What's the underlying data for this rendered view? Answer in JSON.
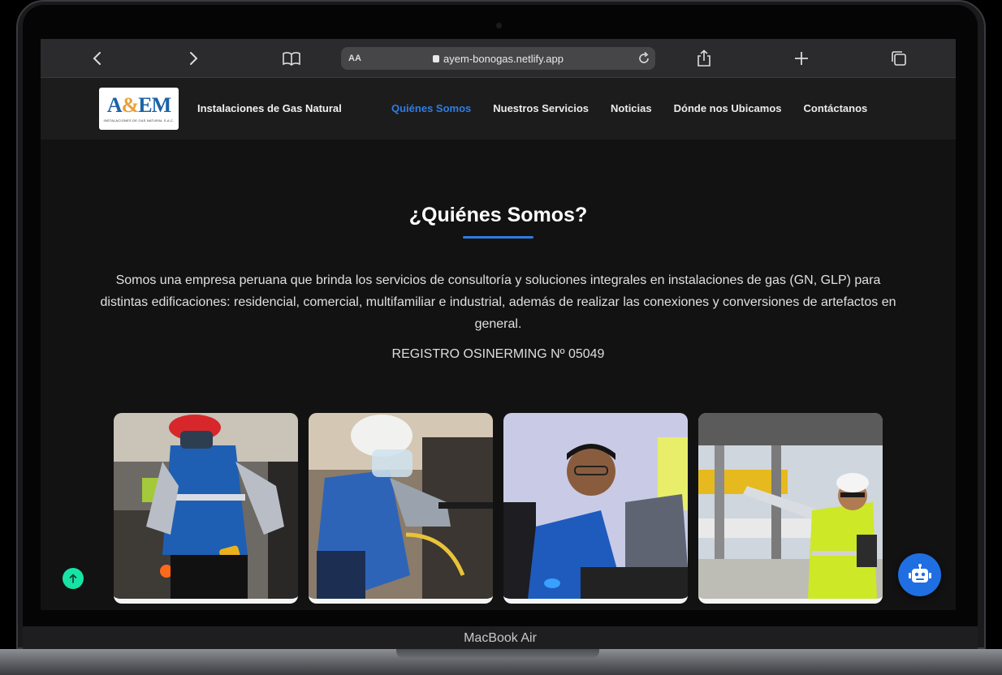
{
  "device": {
    "label": "MacBook Air"
  },
  "browser": {
    "text_size_label": "AA",
    "url": "ayem-bonogas.netlify.app",
    "icons": [
      "back-icon",
      "forward-icon",
      "bookmarks-icon",
      "lock-icon",
      "reload-icon",
      "share-icon",
      "new-tab-icon",
      "tabs-icon"
    ]
  },
  "site": {
    "brand": "Instalaciones de Gas Natural",
    "logo": {
      "mark_left": "A",
      "mark_amp": "&",
      "mark_right": "EM",
      "sub": "INSTALACIONES DE GAS NATURAL S.A.C."
    },
    "nav": [
      {
        "label": "Quiénes Somos",
        "active": true
      },
      {
        "label": "Nuestros Servicios",
        "active": false
      },
      {
        "label": "Noticias",
        "active": false
      },
      {
        "label": "Dónde nos Ubicamos",
        "active": false
      },
      {
        "label": "Contáctanos",
        "active": false
      }
    ],
    "accent_color": "#2f7de1"
  },
  "about": {
    "title": "¿Quiénes Somos?",
    "text": "Somos una empresa peruana que brinda los servicios de consultoría y soluciones integrales en instalaciones de gas (GN, GLP) para distintas edificaciones: residencial, comercial, multifamiliar e industrial, además de realizar las conexiones y conversiones de artefactos en general.",
    "registro": "REGISTRO OSINERMING Nº 05049"
  },
  "photos": [
    {
      "name": "technician-welding-photo"
    },
    {
      "name": "technician-installing-photo"
    },
    {
      "name": "engineer-at-laptop-photo"
    },
    {
      "name": "supervisor-at-plant-photo"
    }
  ],
  "floating": {
    "scroll_top_color": "#17e3a5",
    "chatbot_color": "#1f6fe3"
  }
}
